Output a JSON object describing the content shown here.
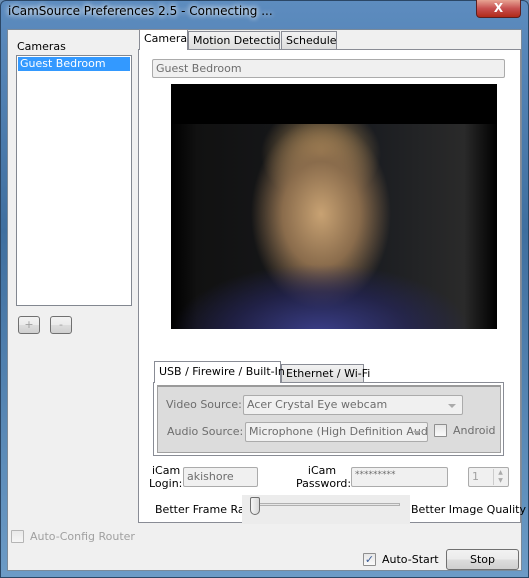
{
  "window": {
    "title": "iCamSource Preferences 2.5 - Connecting ...",
    "close_label": "X"
  },
  "cameras": {
    "label": "Cameras",
    "items": [
      {
        "label": "Guest Bedroom",
        "selected": true
      }
    ],
    "add_label": "+",
    "remove_label": "-"
  },
  "tabs": [
    {
      "label": "Camera",
      "active": true
    },
    {
      "label": "Motion Detection"
    },
    {
      "label": "Schedule"
    }
  ],
  "camera": {
    "name_value": "Guest Bedroom",
    "source_tabs": [
      {
        "label": "USB / Firewire / Built-In",
        "active": true
      },
      {
        "label": "Ethernet / Wi-Fi"
      }
    ],
    "video_source_label": "Video Source:",
    "video_source_value": "Acer Crystal Eye webcam",
    "audio_source_label": "Audio Source:",
    "audio_source_value": "Microphone (High Definition Aud",
    "android_label": "Android",
    "android_checked": false,
    "login_label_1": "iCam",
    "login_label_2": "Login:",
    "login_value": "akishore",
    "password_label_1": "iCam",
    "password_label_2": "Password:",
    "password_value": "*********",
    "spinner_value": "1",
    "slider_left_label": "Better Frame Rate",
    "slider_right_label": "Better Image Quality",
    "slider_value": 0
  },
  "footer": {
    "auto_config_label": "Auto-Config Router",
    "auto_config_checked": false,
    "auto_start_label": "Auto-Start",
    "auto_start_checked": true,
    "stop_label": "Stop"
  },
  "colors": {
    "selection": "#3399ff",
    "title_bar": "#4f80b2"
  }
}
